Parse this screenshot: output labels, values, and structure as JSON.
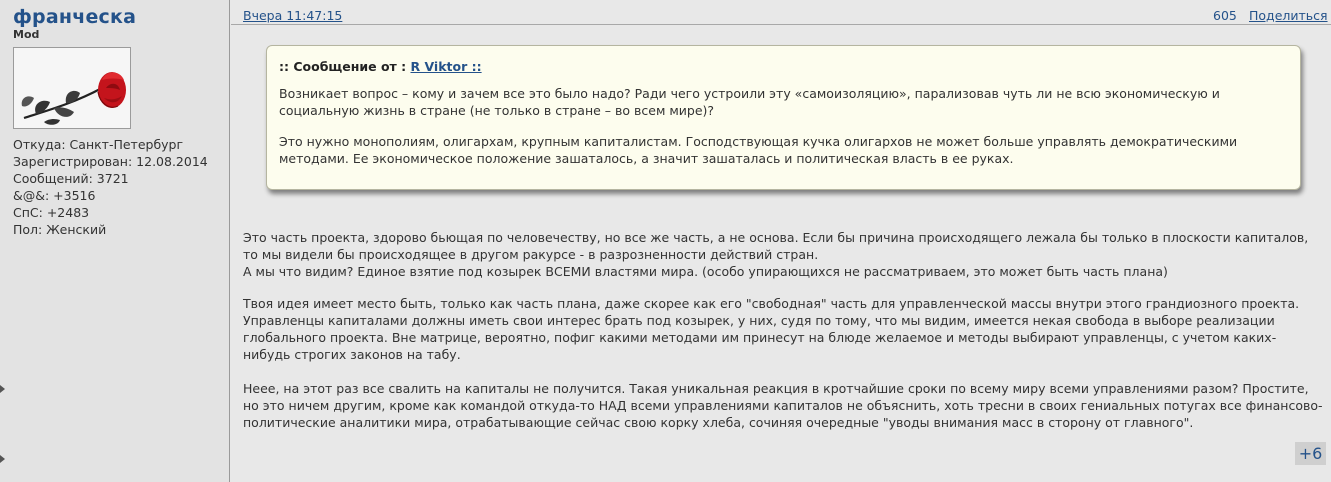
{
  "author": {
    "name": "франческа",
    "rank": "Mod",
    "details": [
      "Откуда: Санкт-Петербург",
      "Зарегистрирован: 12.08.2014",
      "Сообщений: 3721",
      "&@&: +3516",
      "СпС: +2483",
      "Пол: Женский"
    ]
  },
  "post": {
    "date": "Вчера 11:47:15",
    "number": "605",
    "share_label": "Поделиться",
    "quote": {
      "prefix": ":: Сообщение от :",
      "author": "R Viktor ::",
      "paragraphs": [
        "Возникает вопрос – кому и зачем все это было надо? Ради чего устроили эту «самоизоляцию», парализовав чуть ли не всю экономическую и социальную жизнь в стране (не только в стране – во всем мире)?",
        "Это нужно монополиям, олигархам, крупным капиталистам. Господствующая кучка олигархов не может больше управлять демократическими методами. Ее экономическое положение зашаталось, а значит зашаталась и политическая власть в ее руках."
      ]
    },
    "paragraphs": [
      "Это часть проекта, здорово бьющая по человечеству, но все же часть, а не основа. Если бы причина происходящего лежала бы только в плоскости капиталов, то мы видели бы происходящее в другом ракурсе - в разрозненности действий стран.",
      "А мы что видим? Единое взятие под козырек ВСЕМИ властями мира. (особо упирающихся не рассматриваем, это может быть часть плана)",
      "Твоя идея имеет место быть, только как часть плана, даже скорее как его \"свободная\" часть для управленческой массы внутри этого грандиозного проекта. Управленцы капиталами должны иметь свои интерес брать под козырек, у них, судя по тому, что мы видим, имеется некая свобода в выборе реализации глобального проекта. Вне матрице, вероятно, пофиг какими методами им принесут на блюде желаемое и методы выбирают управленцы, с учетом каких-нибудь строгих законов на табу.",
      "Неее, на этот раз все свалить на капиталы не получится. Такая уникальная реакция в кротчайшие сроки по всему миру всеми управлениями разом? Простите, но это ничем другим, кроме как командой откуда-то НАД всеми управлениями капиталов не объяснить, хоть тресни в своих гениальных потугах все финансово-политические аналитики мира, отрабатывающие сейчас свою корку хлеба, сочиняя очередные \"уводы внимания масс в сторону от главного\"."
    ],
    "rating": "+6"
  },
  "icons": {
    "avatar": "rose-avatar-icon",
    "left_arrows": "expand-arrow-icon"
  },
  "colors": {
    "link": "#24528a",
    "quote_bg": "#fdfdee",
    "sidebar_bg": "#e3e3e3",
    "page_bg": "#e8e8e8"
  }
}
